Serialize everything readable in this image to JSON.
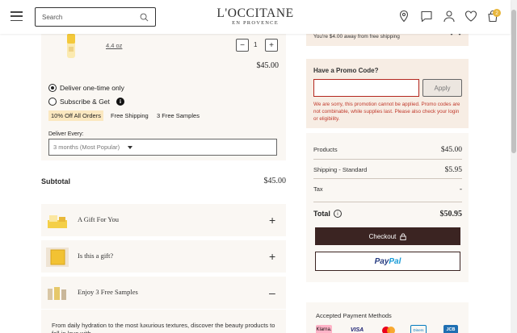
{
  "header": {
    "search_placeholder": "Search",
    "logo_line1": "L'OCCITANE",
    "logo_line2": "EN PROVENCE",
    "bag_count": "2",
    "icons": [
      "menu-icon",
      "search-icon",
      "location-icon",
      "chat-icon",
      "account-icon",
      "heart-icon",
      "bag-icon"
    ]
  },
  "cart_item": {
    "size": "4.4 oz",
    "quantity": "1",
    "price": "$45.00",
    "delivery_options": [
      "Deliver one-time only",
      "Subscribe & Get"
    ],
    "selected_option": "Deliver one-time only",
    "subscription_perks": [
      "10% Off All Orders",
      "Free Shipping",
      "3 Free Samples"
    ],
    "deliver_every_label": "Deliver Every:",
    "deliver_every_value": "3 months (Most Popular)"
  },
  "subtotal": {
    "label": "Subtotal",
    "value": "$45.00"
  },
  "accordions": [
    {
      "title": "A Gift For You",
      "state": "+"
    },
    {
      "title": "Is this a gift?",
      "state": "+"
    },
    {
      "title": "Enjoy 3 Free Samples",
      "state": "–"
    }
  ],
  "samples_text": "From daily hydration to the most luxurious textures, discover the beauty products to fall in love with.",
  "shipping_notice": "You're $4.00 away from free shipping",
  "promo": {
    "heading": "Have a Promo Code?",
    "input_value": "",
    "apply_label": "Apply",
    "error": "We are sorry, this promotion cannot be applied. Promo codes are not combinable, while supplies last. Please also check your login or eligibility."
  },
  "summary": {
    "products_label": "Products",
    "products_value": "$45.00",
    "shipping_label": "Shipping - Standard",
    "shipping_value": "$5.95",
    "tax_label": "Tax",
    "tax_value": "-",
    "total_label": "Total",
    "total_value": "$50.95"
  },
  "checkout_label": "Checkout",
  "paypal_label_1": "Pay",
  "paypal_label_2": "Pal",
  "payment_methods": {
    "heading": "Accepted Payment Methods",
    "methods": [
      "Klarna.",
      "VISA",
      "mastercard",
      "Diners",
      "JCB"
    ]
  },
  "colors": {
    "accent_dark": "#3b2422",
    "beige": "#f7ede4",
    "panel": "#faf7f3",
    "error": "#c0392b",
    "badge": "#e8b63b"
  }
}
